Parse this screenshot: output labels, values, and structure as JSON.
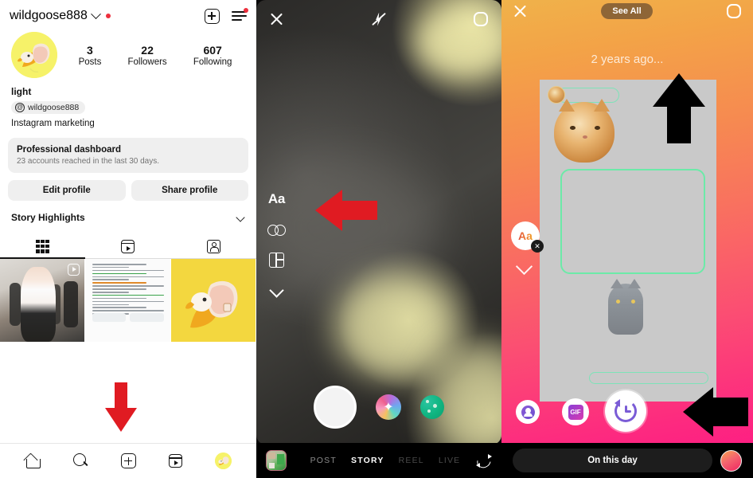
{
  "profile": {
    "username": "wildgoose888",
    "stats": [
      {
        "num": "3",
        "label": "Posts"
      },
      {
        "num": "22",
        "label": "Followers"
      },
      {
        "num": "607",
        "label": "Following"
      }
    ],
    "bio_name": "light",
    "bio_chip": "wildgoose888",
    "bio_category": "Instagram marketing",
    "dashboard_title": "Professional dashboard",
    "dashboard_sub": "23 accounts reached in the last 30 days.",
    "edit_profile": "Edit profile",
    "share_profile": "Share profile",
    "story_highlights": "Story Highlights",
    "tabs": [
      {
        "name": "grid",
        "icon": "grid-icon"
      },
      {
        "name": "reels",
        "icon": "reels-icon"
      },
      {
        "name": "tagged",
        "icon": "tagged-icon"
      }
    ],
    "nav": [
      {
        "name": "home",
        "icon": "home-icon"
      },
      {
        "name": "search",
        "icon": "search-icon"
      },
      {
        "name": "create",
        "icon": "plus-square-icon"
      },
      {
        "name": "reels",
        "icon": "reels-icon"
      },
      {
        "name": "profile",
        "icon": "avatar-icon"
      }
    ],
    "icons": {
      "chevron": "chevron-down-icon",
      "create": "plus-square-icon",
      "menu": "hamburger-menu-icon"
    }
  },
  "camera": {
    "close": "close-icon",
    "flash": "flash-off-icon",
    "settings": "settings-gear-icon",
    "tools": [
      {
        "name": "text-tool",
        "label": "Aa"
      },
      {
        "name": "boomerang-tool",
        "label": "infinity-icon"
      },
      {
        "name": "layout-tool",
        "label": "layout-icon"
      },
      {
        "name": "more-tools",
        "label": "chevron-down-icon"
      }
    ],
    "modes": [
      {
        "label": "POST",
        "active": false
      },
      {
        "label": "STORY",
        "active": true
      },
      {
        "label": "REEL",
        "active": false
      },
      {
        "label": "LIVE",
        "active": false
      }
    ],
    "flip_camera": "flip-camera-icon",
    "gallery": "gallery-thumbnail",
    "shutter": "capture-button",
    "effects": [
      {
        "name": "effects-sparkle"
      },
      {
        "name": "effects-green"
      }
    ]
  },
  "memory": {
    "close": "close-icon",
    "see_all": "See All",
    "settings": "settings-gear-icon",
    "timestamp": "2 years ago...",
    "text_tool_label": "Aa",
    "text_tool_remove": "✕",
    "stickers": [
      {
        "name": "mention-sticker"
      },
      {
        "name": "gif-sticker",
        "label": "GIF"
      },
      {
        "name": "memory-time-sticker"
      }
    ],
    "on_this_day": "On this day"
  },
  "colors": {
    "instagram_red": "#ed2f3d",
    "annotation_red": "#e01b22",
    "annotation_black": "#000000",
    "chip_gray": "#efefef",
    "memory_gradient_start": "#f0b24a",
    "memory_gradient_end": "#fe1585",
    "accent_green": "#6ceaa8",
    "goose_yellow": "#f6f269"
  }
}
